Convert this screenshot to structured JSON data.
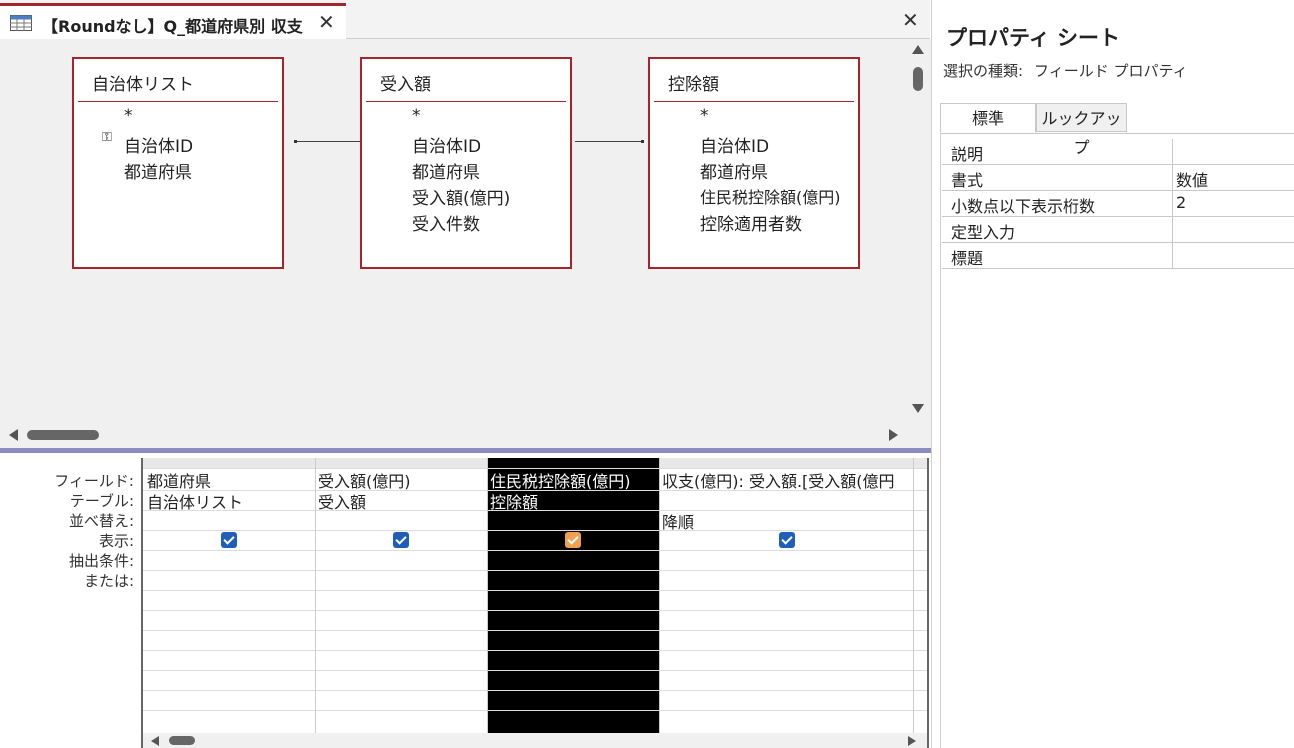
{
  "tab": {
    "title": "【Roundなし】Q_都道府県別 収支"
  },
  "diagram": {
    "tables": [
      {
        "name": "自治体リスト",
        "fields": [
          "*",
          "自治体ID",
          "都道府県"
        ]
      },
      {
        "name": "受入額",
        "fields": [
          "*",
          "自治体ID",
          "都道府県",
          "受入額(億円)",
          "受入件数"
        ]
      },
      {
        "name": "控除額",
        "fields": [
          "*",
          "自治体ID",
          "都道府県",
          "住民税控除額(億円)",
          "控除適用者数"
        ]
      }
    ]
  },
  "grid": {
    "row_labels": [
      "フィールド:",
      "テーブル:",
      "並べ替え:",
      "表示:",
      "抽出条件:",
      "または:"
    ],
    "columns": [
      {
        "field": "都道府県",
        "table": "自治体リスト",
        "sort": "",
        "show": true
      },
      {
        "field": "受入額(億円)",
        "table": "受入額",
        "sort": "",
        "show": true
      },
      {
        "field": "住民税控除額(億円)",
        "table": "控除額",
        "sort": "",
        "show": true
      },
      {
        "field": "収支(億円): 受入額.[受入額(億円",
        "table": "",
        "sort": "降順",
        "show": true
      }
    ]
  },
  "property_sheet": {
    "title": "プロパティ シート",
    "selection_type_label": "選択の種類:",
    "selection_type_value": "フィールド プロパティ",
    "tabs": [
      "標準",
      "ルックアップ"
    ],
    "properties": [
      {
        "name": "説明",
        "value": ""
      },
      {
        "name": "書式",
        "value": "数値"
      },
      {
        "name": "小数点以下表示桁数",
        "value": "2"
      },
      {
        "name": "定型入力",
        "value": ""
      },
      {
        "name": "標題",
        "value": ""
      }
    ]
  }
}
